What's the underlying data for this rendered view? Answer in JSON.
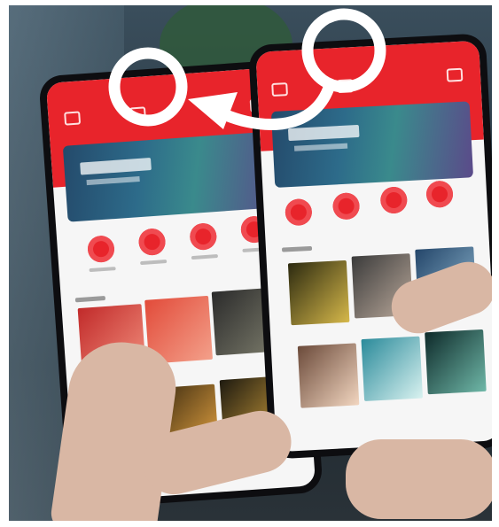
{
  "scene": {
    "description_colors": {
      "app_red": "#e8242b",
      "annotation_stroke": "#ffffff"
    },
    "icons": [
      "home-icon",
      "menu-icon",
      "search-icon"
    ],
    "annotation": {
      "marks": [
        "circle-left",
        "circle-right",
        "curved-arrow-right-to-left"
      ]
    }
  }
}
